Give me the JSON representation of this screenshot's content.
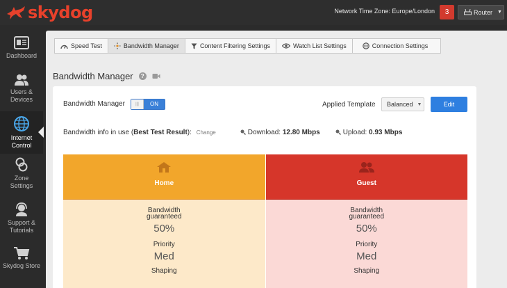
{
  "app": {
    "logo_text": "skydog",
    "brand_color": "#e8412b",
    "timezone_label": "Network Time Zone: Europe/London",
    "notification_count": "3",
    "router_label": "Router"
  },
  "sidebar": {
    "items": [
      {
        "label": "Dashboard",
        "icon": "dashboard-icon"
      },
      {
        "label": "Users & Devices",
        "icon": "users-icon"
      },
      {
        "label": "Internet Control",
        "icon": "globe-icon"
      },
      {
        "label": "Zone Settings",
        "icon": "zone-icon"
      },
      {
        "label": "Support & Tutorials",
        "icon": "support-icon"
      },
      {
        "label": "Skydog Store",
        "icon": "cart-icon"
      }
    ],
    "active_index": 2
  },
  "tabs": [
    {
      "label": "Speed Test",
      "icon": "speedometer-icon"
    },
    {
      "label": "Bandwidth Manager",
      "icon": "bandwidth-icon"
    },
    {
      "label": "Content Filtering Settings",
      "icon": "filter-icon"
    },
    {
      "label": "Watch List Settings",
      "icon": "eye-icon"
    },
    {
      "label": "Connection Settings",
      "icon": "globe-icon"
    }
  ],
  "active_tab": 1,
  "page": {
    "title": "Bandwidth Manager",
    "help_glyph": "?",
    "bandwidth_manager_label": "Bandwidth Manager",
    "toggle_state": "ON",
    "applied_template_label": "Applied Template",
    "template_value": "Balanced",
    "edit_label": "Edit",
    "info_prefix": "Bandwidth info in use (",
    "info_bold": "Best Test Result",
    "info_suffix": "):",
    "change_label": "Change",
    "download_label": "Download:",
    "download_value": "12.80 Mbps",
    "upload_label": "Upload:",
    "upload_value": "0.93 Mbps"
  },
  "zones": [
    {
      "name": "Home",
      "color": "#f2a62b",
      "bandwidth_label": "Bandwidth guaranteed",
      "bandwidth_value": "50%",
      "priority_label": "Priority",
      "priority_value": "Med",
      "shaping_label": "Shaping"
    },
    {
      "name": "Guest",
      "color": "#d6362a",
      "bandwidth_label": "Bandwidth guaranteed",
      "bandwidth_value": "50%",
      "priority_label": "Priority",
      "priority_value": "Med",
      "shaping_label": "Shaping"
    }
  ]
}
